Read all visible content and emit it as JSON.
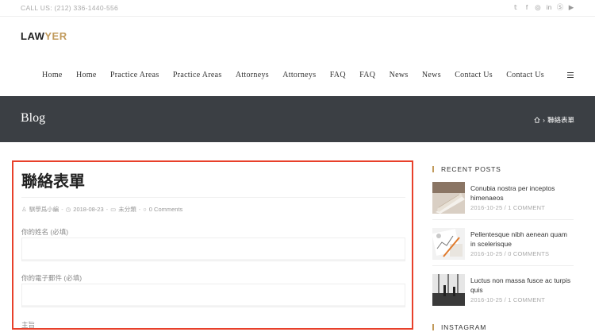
{
  "topbar": {
    "phone": "CALL US: (212) 336-1440-556",
    "social_icons": [
      "twitter-icon",
      "facebook-icon",
      "instagram-icon",
      "linkedin-icon",
      "skype-icon",
      "youtube-icon"
    ]
  },
  "logo": {
    "part1": "LAW",
    "part2": "YER"
  },
  "nav": {
    "items": [
      "Home",
      "Home",
      "Practice Areas",
      "Practice Areas",
      "Attorneys",
      "Attorneys",
      "FAQ",
      "FAQ",
      "News",
      "News",
      "Contact Us",
      "Contact Us"
    ]
  },
  "banner": {
    "title": "Blog",
    "breadcrumb_current": "聯絡表單"
  },
  "post": {
    "title": "聯絡表單",
    "author": "騏學爲小編",
    "date": "2018-08-23",
    "category": "未分類",
    "comments": "0 Comments",
    "fields": [
      {
        "label": "你的姓名 (必填)"
      },
      {
        "label": "你的電子郵件 (必填)"
      },
      {
        "label": "主旨"
      }
    ]
  },
  "sidebar": {
    "recent_heading": "RECENT POSTS",
    "recent_posts": [
      {
        "title": "Conubia nostra per inceptos himenaeos",
        "date": "2016-10-25",
        "comments": "1 COMMENT"
      },
      {
        "title": "Pellentesque nibh aenean quam in scelerisque",
        "date": "2016-10-25",
        "comments": "0 COMMENTS"
      },
      {
        "title": "Luctus non massa fusce ac turpis quis",
        "date": "2016-10-25",
        "comments": "1 COMMENT"
      }
    ],
    "instagram_heading": "INSTAGRAM"
  },
  "colors": {
    "accent": "#c19a5b",
    "banner": "#3b3f44",
    "highlight_border": "#e8402a"
  }
}
